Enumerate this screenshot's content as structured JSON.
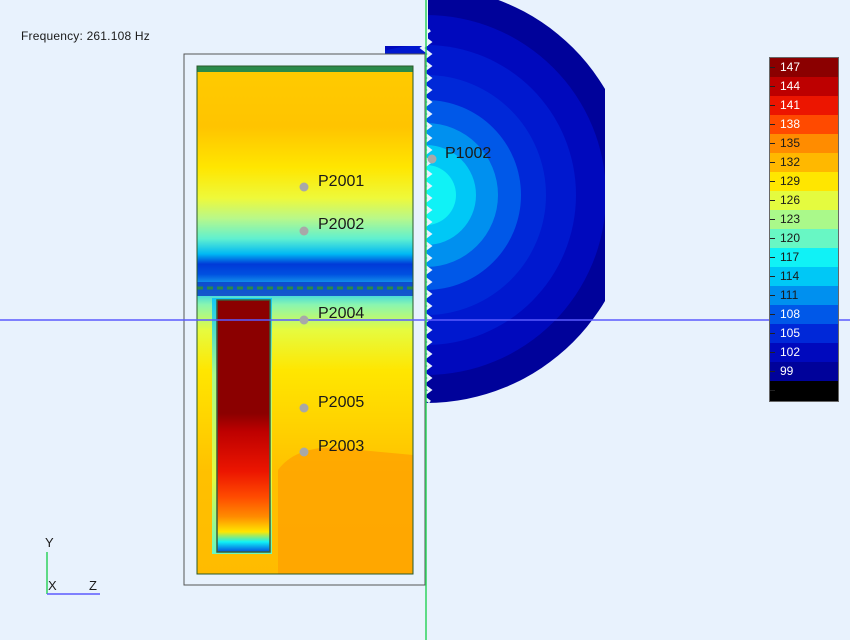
{
  "frequency_label": "Frequency: 261.108 Hz",
  "probes": [
    {
      "id": "p1002",
      "label": "P1002"
    },
    {
      "id": "p2001",
      "label": "P2001"
    },
    {
      "id": "p2002",
      "label": "P2002"
    },
    {
      "id": "p2004",
      "label": "P2004"
    },
    {
      "id": "p2005",
      "label": "P2005"
    },
    {
      "id": "p2003",
      "label": "P2003"
    }
  ],
  "axes_triad": {
    "y": "Y",
    "x": "X",
    "z": "Z"
  },
  "chart_data": {
    "type": "heatmap",
    "legend_placement": "right",
    "scale_levels": [
      {
        "value": "147",
        "color": "#8b0000"
      },
      {
        "value": "144",
        "color": "#bd0000"
      },
      {
        "value": "141",
        "color": "#ec1500"
      },
      {
        "value": "138",
        "color": "#ff4a00"
      },
      {
        "value": "135",
        "color": "#ff8c00"
      },
      {
        "value": "132",
        "color": "#ffb800"
      },
      {
        "value": "129",
        "color": "#ffe600"
      },
      {
        "value": "126",
        "color": "#e4fb3f"
      },
      {
        "value": "123",
        "color": "#aaf98a"
      },
      {
        "value": "120",
        "color": "#68f7c4"
      },
      {
        "value": "117",
        "color": "#10f2f6"
      },
      {
        "value": "114",
        "color": "#00c8f6"
      },
      {
        "value": "111",
        "color": "#0090ef"
      },
      {
        "value": "108",
        "color": "#0058e8"
      },
      {
        "value": "105",
        "color": "#0028d8"
      },
      {
        "value": "102",
        "color": "#0009bd"
      },
      {
        "value": "99",
        "color": "#00029a"
      },
      {
        "value": "",
        "color": "#000000"
      }
    ]
  }
}
